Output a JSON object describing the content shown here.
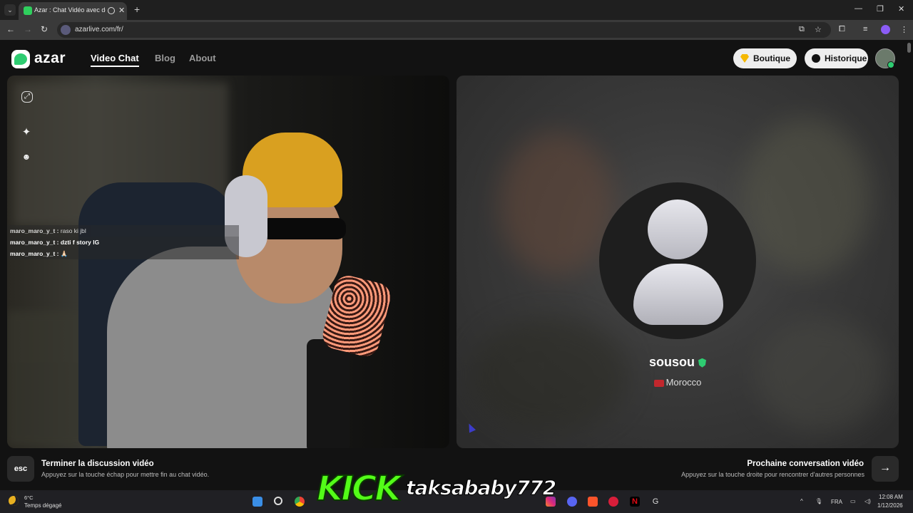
{
  "browser": {
    "tab_title": "Azar : Chat Vidéo avec de",
    "url": "azarlive.com/fr/"
  },
  "site": {
    "logo_text": "azar",
    "nav": [
      {
        "label": "Video Chat",
        "active": true
      },
      {
        "label": "Blog",
        "active": false
      },
      {
        "label": "About",
        "active": false
      }
    ],
    "shop_label": "Boutique",
    "history_label": "Historique"
  },
  "chat": {
    "lines": [
      {
        "user": "maro_maro_y_t :",
        "text": "raso ki jbl"
      },
      {
        "user": "maro_maro_y_t :",
        "text": "dzti f story IG"
      },
      {
        "user": "maro_maro_y_t :",
        "text": "🙏🏻"
      }
    ]
  },
  "peer": {
    "name": "sousou",
    "country": "Morocco"
  },
  "hints": {
    "end_key": "esc",
    "end_title": "Terminer la discussion vidéo",
    "end_sub": "Appuyez sur la touche échap pour mettre fin au chat vidéo.",
    "next_title": "Prochaine conversation vidéo",
    "next_sub": "Appuyez sur la touche droite pour rencontrer d'autres personnes"
  },
  "taskbar": {
    "temp": "6°C",
    "condition": "Temps dégagé",
    "lang": "FRA",
    "time": "12:08 AM",
    "date": "1/12/2026"
  },
  "overlay": {
    "brand": "KICK",
    "username": "taksababy772"
  },
  "colors": {
    "accent_green": "#2ecc71",
    "kick_green": "#53fc18",
    "gem_gold": "#f5b800"
  }
}
